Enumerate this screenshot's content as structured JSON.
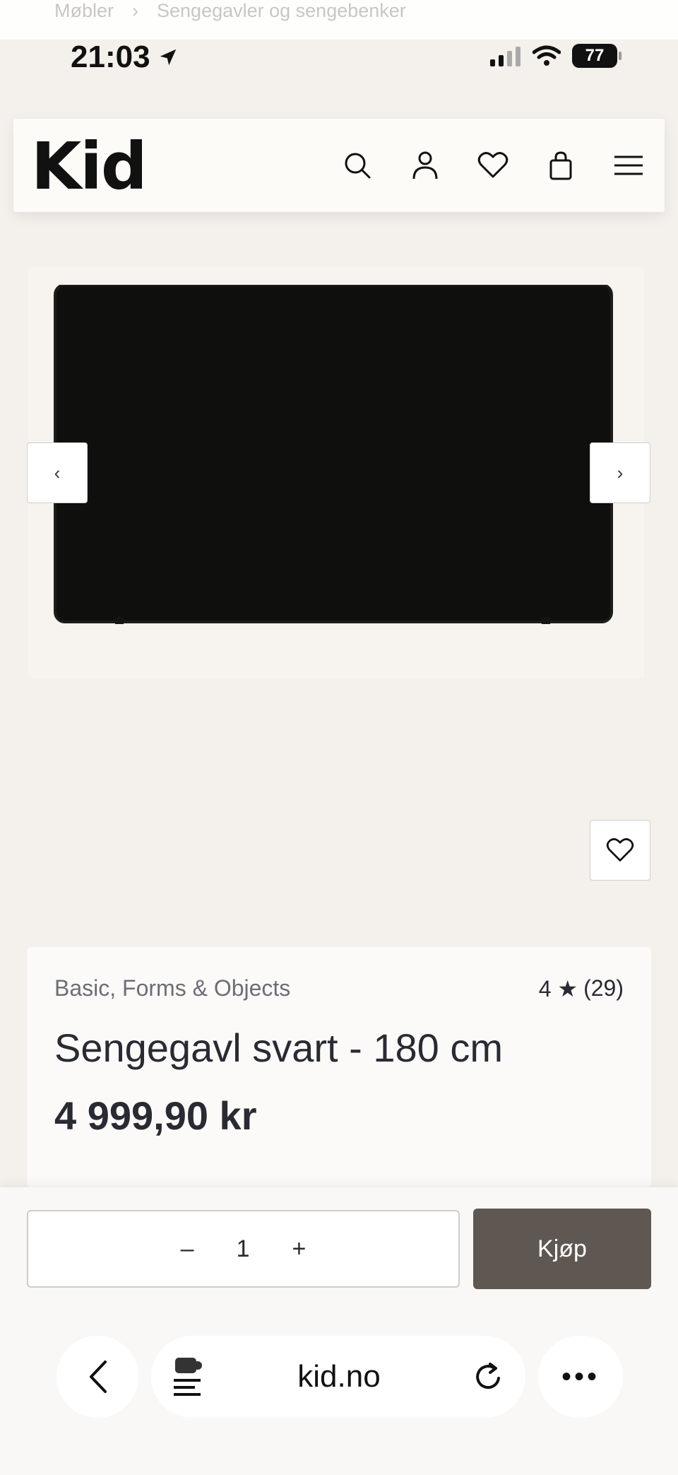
{
  "breadcrumb": {
    "items": [
      "Møbler",
      "›",
      "Sengegavler og sengebenker"
    ]
  },
  "status": {
    "time": "21:03",
    "battery": "77"
  },
  "header": {
    "logo": "Kid"
  },
  "product": {
    "brand": "Basic, Forms & Objects",
    "rating": "4 ★",
    "review_count": "(29)",
    "title": "Sengegavl svart - 180 cm",
    "price": "4 999,90 kr"
  },
  "buy": {
    "quantity": "1",
    "minus": "–",
    "plus": "+",
    "buy_label": "Kjøp"
  },
  "browser": {
    "url": "kid.no",
    "more": "•••"
  },
  "gallery": {
    "prev": "‹",
    "next": "›"
  },
  "colors": {
    "background": "#f4f1ec",
    "buy_button": "#5f5852",
    "text": "#2a2a33"
  }
}
